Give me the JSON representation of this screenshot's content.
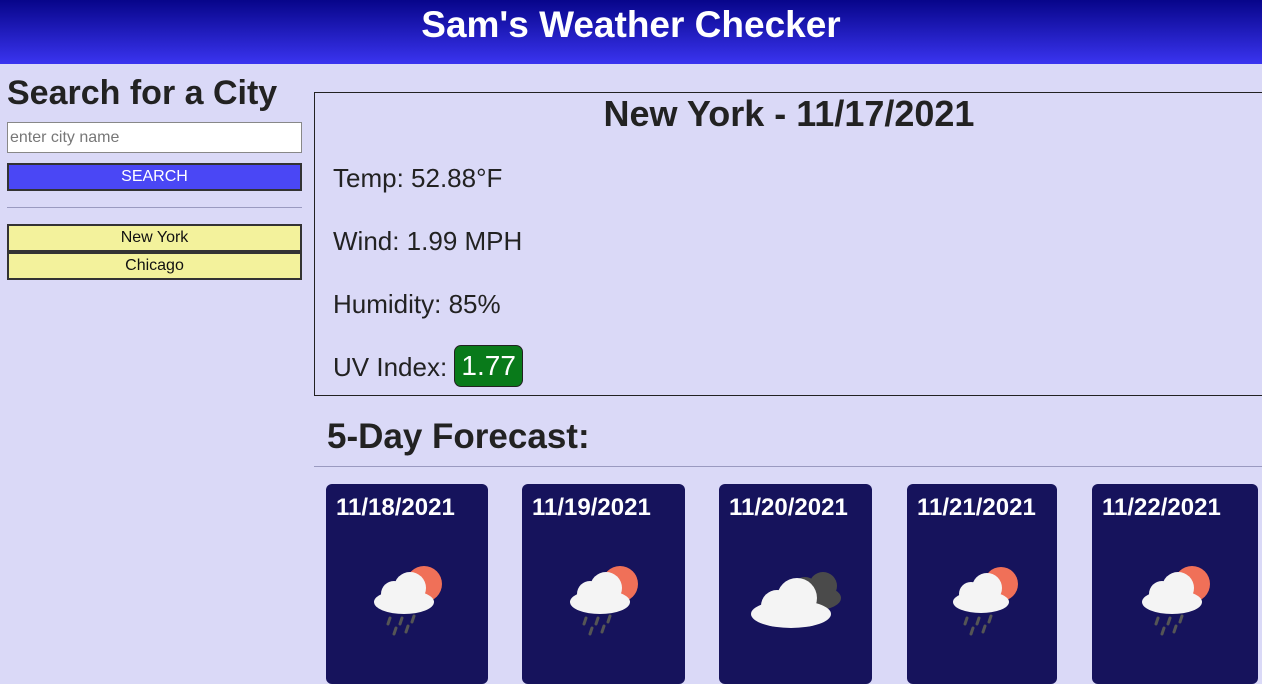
{
  "header": {
    "title": "Sam's Weather Checker"
  },
  "sidebar": {
    "heading": "Search for a City",
    "search_placeholder": "enter city name",
    "search_value": "",
    "search_button": "SEARCH",
    "history": [
      "New York",
      "Chicago"
    ]
  },
  "current": {
    "title": "New York - 11/17/2021",
    "temp": "Temp: 52.88°F",
    "wind": "Wind: 1.99 MPH",
    "humidity": "Humidity: 85%",
    "uv_label": "UV Index: ",
    "uv_value": "1.77",
    "uv_color": "#097a1a"
  },
  "forecast": {
    "title": "5-Day Forecast:",
    "days": [
      {
        "date": "11/18/2021",
        "icon": "rain-sun-icon"
      },
      {
        "date": "11/19/2021",
        "icon": "rain-sun-icon"
      },
      {
        "date": "11/20/2021",
        "icon": "cloudy-icon"
      },
      {
        "date": "11/21/2021",
        "icon": "rain-sun-icon"
      },
      {
        "date": "11/22/2021",
        "icon": "rain-sun-icon"
      }
    ]
  }
}
